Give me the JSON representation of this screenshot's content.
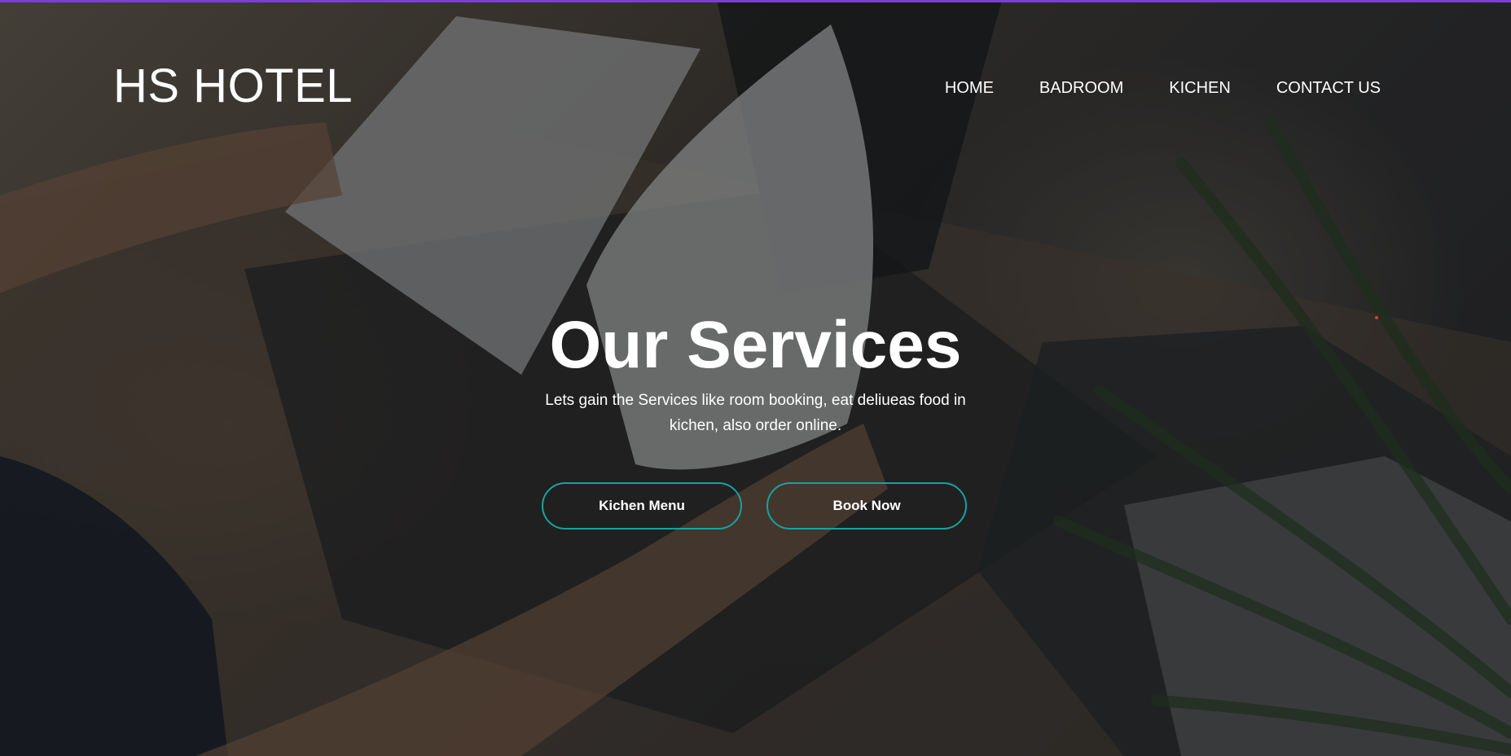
{
  "brand": {
    "logo_text": "HS HOTEL"
  },
  "nav": {
    "items": [
      {
        "label": "HOME"
      },
      {
        "label": "BADROOM"
      },
      {
        "label": "KICHEN"
      },
      {
        "label": "CONTACT US"
      }
    ]
  },
  "hero": {
    "title": "Our Services",
    "subtitle": "Lets gain the Services like room booking, eat deliueas food in kichen, also order online.",
    "buttons": [
      {
        "label": "Kichen Menu"
      },
      {
        "label": "Book Now"
      }
    ]
  },
  "colors": {
    "top_accent": "#7b3fd6",
    "button_border": "#17a2a0",
    "text": "#ffffff"
  }
}
